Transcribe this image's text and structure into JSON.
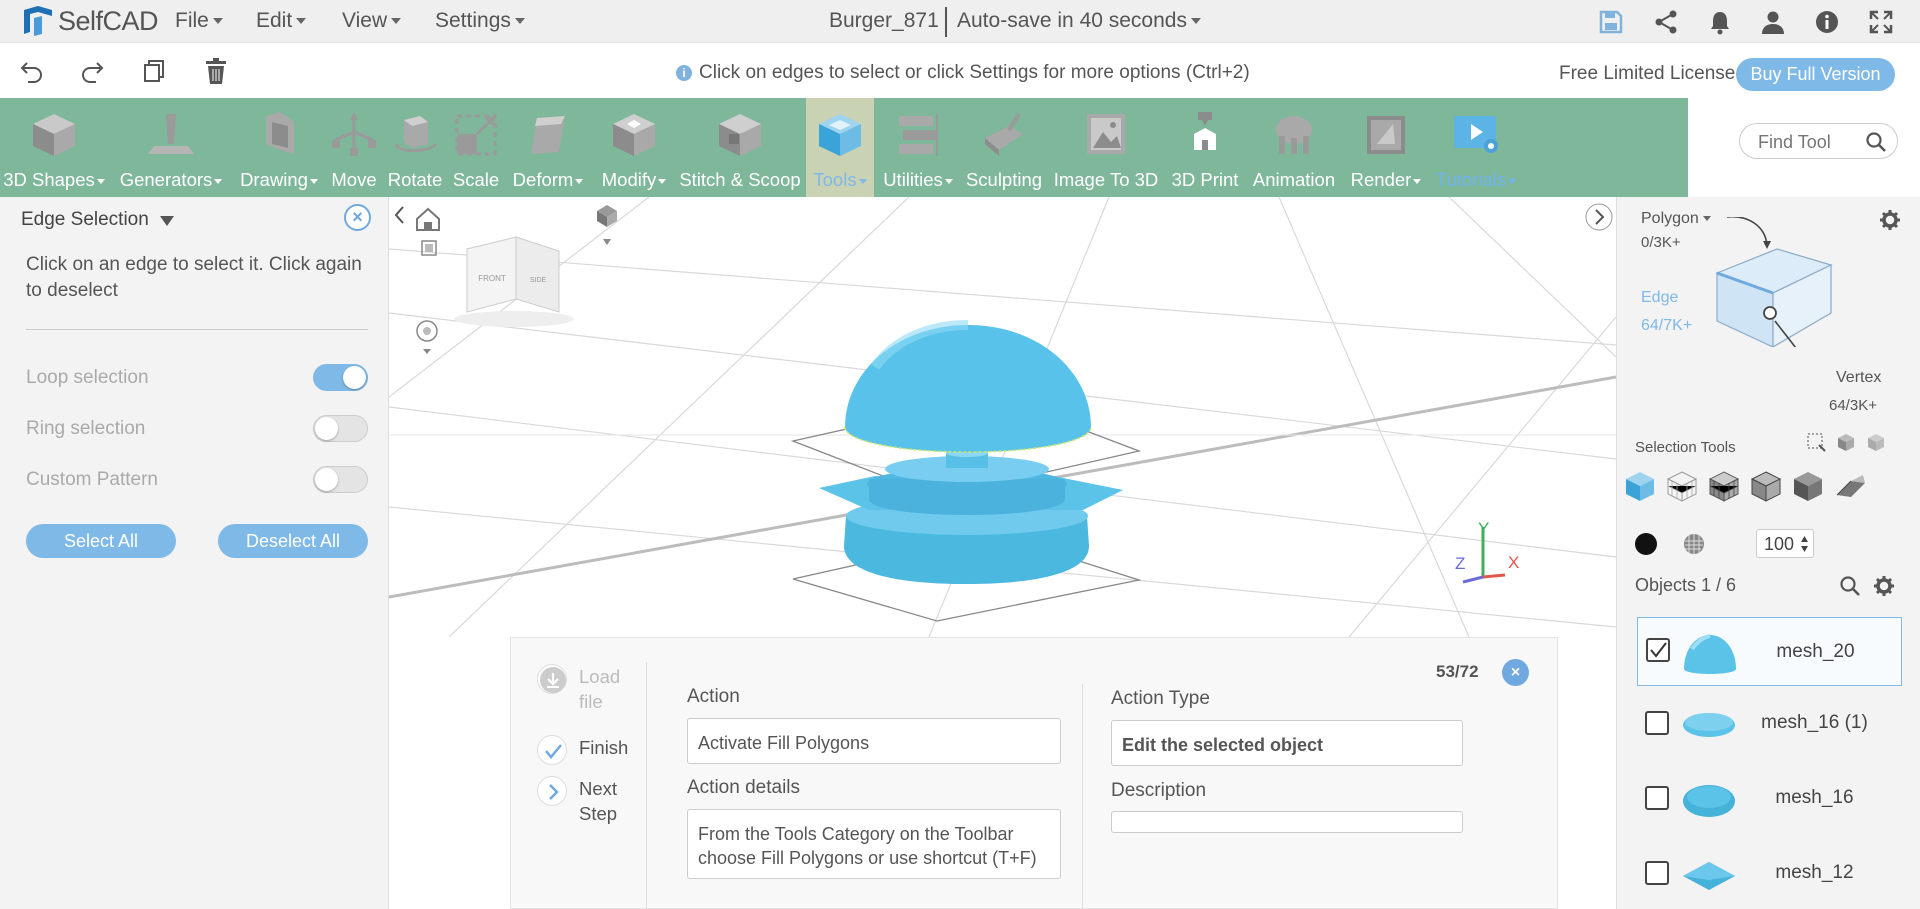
{
  "app": {
    "name": "SelfCAD"
  },
  "menus": [
    {
      "label": "File"
    },
    {
      "label": "Edit"
    },
    {
      "label": "View"
    },
    {
      "label": "Settings"
    }
  ],
  "project": {
    "name": "Burger_871",
    "autosave": "Auto-save in 40 seconds"
  },
  "top_icons": [
    "save-icon",
    "share-icon",
    "bell-icon",
    "user-icon",
    "info-icon",
    "fullscreen-icon"
  ],
  "action_icons": [
    "undo-icon",
    "redo-icon",
    "copy-icon",
    "delete-icon"
  ],
  "hint": "Click on edges to select or click Settings for more options (Ctrl+2)",
  "license": {
    "text": "Free Limited License",
    "buy_label": "Buy Full Version"
  },
  "toolbar": {
    "bg_color": "#7fb79b",
    "tools": [
      {
        "label": "3D Shapes",
        "dropdown": true
      },
      {
        "label": "Generators",
        "dropdown": true
      },
      {
        "label": "Drawing",
        "dropdown": true
      },
      {
        "label": "Move",
        "dropdown": false
      },
      {
        "label": "Rotate",
        "dropdown": false
      },
      {
        "label": "Scale",
        "dropdown": false
      },
      {
        "label": "Deform",
        "dropdown": true
      },
      {
        "label": "Modify",
        "dropdown": true
      },
      {
        "label": "Stitch & Scoop",
        "dropdown": false
      },
      {
        "label": "Tools",
        "dropdown": true,
        "active": true
      },
      {
        "label": "Utilities",
        "dropdown": true
      },
      {
        "label": "Sculpting",
        "dropdown": false
      },
      {
        "label": "Image To 3D",
        "dropdown": false
      },
      {
        "label": "3D Print",
        "dropdown": false
      },
      {
        "label": "Animation",
        "dropdown": false
      },
      {
        "label": "Render",
        "dropdown": true
      },
      {
        "label": "Tutorials",
        "dropdown": true
      }
    ],
    "find_placeholder": "Find Tool"
  },
  "edge_panel": {
    "title": "Edge Selection",
    "description": "Click on an edge to select it. Click again to deselect",
    "options": [
      {
        "label": "Loop selection",
        "on": true
      },
      {
        "label": "Ring selection",
        "on": false
      },
      {
        "label": "Custom Pattern",
        "on": false
      }
    ],
    "select_all": "Select All",
    "deselect_all": "Deselect All"
  },
  "viewcube": {
    "front": "FRONT",
    "side": "SIDE"
  },
  "axes": {
    "x": "X",
    "y": "Y",
    "z": "Z"
  },
  "tutorial": {
    "steps": [
      {
        "label": "Load file",
        "state": "disabled"
      },
      {
        "label": "Finish",
        "state": "done"
      },
      {
        "label": "Next Step",
        "state": "next"
      }
    ],
    "counter": "53/72",
    "action_label": "Action",
    "action_value": "Activate Fill Polygons",
    "action_type_label": "Action Type",
    "action_type_value": "Edit the selected object",
    "details_label": "Action details",
    "details_value": "From the Tools Category on the Toolbar choose Fill Polygons or use shortcut (T+F)",
    "description_label": "Description",
    "description_value": ""
  },
  "right_panel": {
    "mode": "Polygon",
    "polygon_count": "0/3K+",
    "edge_label": "Edge",
    "edge_count": "64/7K+",
    "vertex_label": "Vertex",
    "vertex_count": "64/3K+",
    "selection_tools": "Selection Tools",
    "opacity_value": "100",
    "objects_label": "Objects 1 / 6",
    "objects": [
      {
        "name": "mesh_20",
        "selected": true
      },
      {
        "name": "mesh_16 (1)",
        "selected": false
      },
      {
        "name": "mesh_16",
        "selected": false
      },
      {
        "name": "mesh_12",
        "selected": false
      }
    ]
  },
  "colors": {
    "accent": "#7fb9e8",
    "model": "#5bc3e5"
  }
}
